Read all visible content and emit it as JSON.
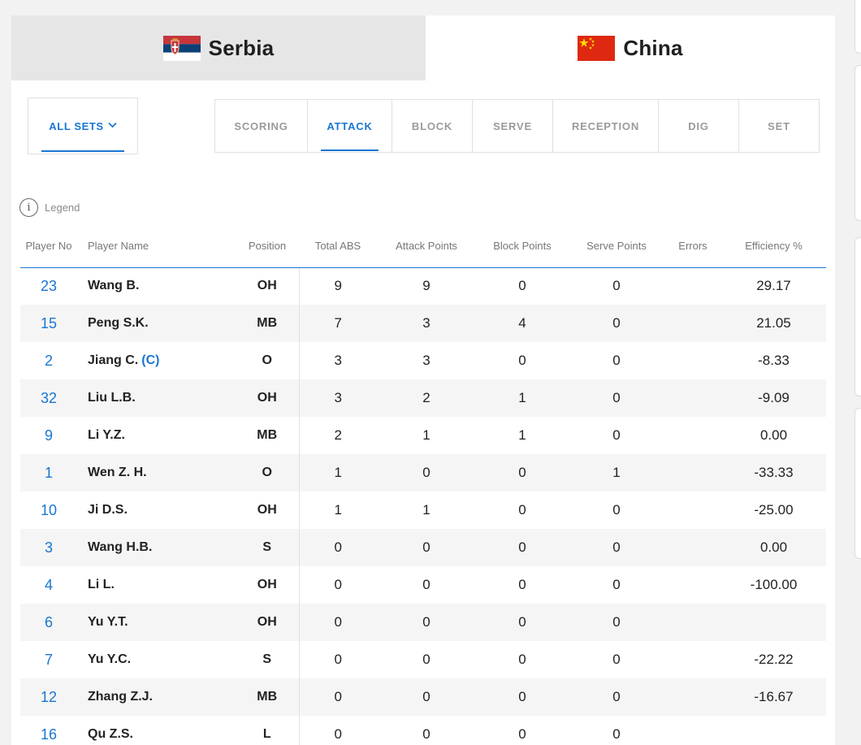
{
  "teams": [
    {
      "name": "Serbia",
      "flag_icon": "serbia-flag-icon",
      "active": false
    },
    {
      "name": "China",
      "flag_icon": "china-flag-icon",
      "active": true
    }
  ],
  "sets_filter": {
    "label": "ALL SETS",
    "icon": "chevron-down-icon"
  },
  "stat_tabs": [
    {
      "label": "SCORING",
      "active": false
    },
    {
      "label": "ATTACK",
      "active": true
    },
    {
      "label": "BLOCK",
      "active": false
    },
    {
      "label": "SERVE",
      "active": false
    },
    {
      "label": "RECEPTION",
      "active": false
    },
    {
      "label": "DIG",
      "active": false
    },
    {
      "label": "SET",
      "active": false
    }
  ],
  "legend": {
    "label": "Legend",
    "icon": "info-icon"
  },
  "table": {
    "headers": {
      "player_no": "Player No",
      "player_name": "Player Name",
      "position": "Position",
      "total_abs": "Total ABS",
      "attack_points": "Attack Points",
      "block_points": "Block Points",
      "serve_points": "Serve Points",
      "errors": "Errors",
      "efficiency": "Efficiency %"
    },
    "rows": [
      {
        "no": "23",
        "name": "Wang B.",
        "captain": "",
        "pos": "OH",
        "abs": "9",
        "ap": "9",
        "bp": "0",
        "sp": "0",
        "err": "",
        "eff": "29.17"
      },
      {
        "no": "15",
        "name": "Peng S.K.",
        "captain": "",
        "pos": "MB",
        "abs": "7",
        "ap": "3",
        "bp": "4",
        "sp": "0",
        "err": "",
        "eff": "21.05"
      },
      {
        "no": "2",
        "name": "Jiang C.",
        "captain": "(C)",
        "pos": "O",
        "abs": "3",
        "ap": "3",
        "bp": "0",
        "sp": "0",
        "err": "",
        "eff": "-8.33"
      },
      {
        "no": "32",
        "name": "Liu L.B.",
        "captain": "",
        "pos": "OH",
        "abs": "3",
        "ap": "2",
        "bp": "1",
        "sp": "0",
        "err": "",
        "eff": "-9.09"
      },
      {
        "no": "9",
        "name": "Li Y.Z.",
        "captain": "",
        "pos": "MB",
        "abs": "2",
        "ap": "1",
        "bp": "1",
        "sp": "0",
        "err": "",
        "eff": "0.00"
      },
      {
        "no": "1",
        "name": "Wen Z. H.",
        "captain": "",
        "pos": "O",
        "abs": "1",
        "ap": "0",
        "bp": "0",
        "sp": "1",
        "err": "",
        "eff": "-33.33"
      },
      {
        "no": "10",
        "name": "Ji D.S.",
        "captain": "",
        "pos": "OH",
        "abs": "1",
        "ap": "1",
        "bp": "0",
        "sp": "0",
        "err": "",
        "eff": "-25.00"
      },
      {
        "no": "3",
        "name": "Wang H.B.",
        "captain": "",
        "pos": "S",
        "abs": "0",
        "ap": "0",
        "bp": "0",
        "sp": "0",
        "err": "",
        "eff": "0.00"
      },
      {
        "no": "4",
        "name": "Li L.",
        "captain": "",
        "pos": "OH",
        "abs": "0",
        "ap": "0",
        "bp": "0",
        "sp": "0",
        "err": "",
        "eff": "-100.00"
      },
      {
        "no": "6",
        "name": "Yu Y.T.",
        "captain": "",
        "pos": "OH",
        "abs": "0",
        "ap": "0",
        "bp": "0",
        "sp": "0",
        "err": "",
        "eff": ""
      },
      {
        "no": "7",
        "name": "Yu Y.C.",
        "captain": "",
        "pos": "S",
        "abs": "0",
        "ap": "0",
        "bp": "0",
        "sp": "0",
        "err": "",
        "eff": "-22.22"
      },
      {
        "no": "12",
        "name": "Zhang Z.J.",
        "captain": "",
        "pos": "MB",
        "abs": "0",
        "ap": "0",
        "bp": "0",
        "sp": "0",
        "err": "",
        "eff": "-16.67"
      },
      {
        "no": "16",
        "name": "Qu Z.S.",
        "captain": "",
        "pos": "L",
        "abs": "0",
        "ap": "0",
        "bp": "0",
        "sp": "0",
        "err": "",
        "eff": ""
      }
    ]
  },
  "colors": {
    "accent": "#1976d2",
    "inactive_tab": "#9a9a9a",
    "stripe": "#f5f5f5"
  }
}
